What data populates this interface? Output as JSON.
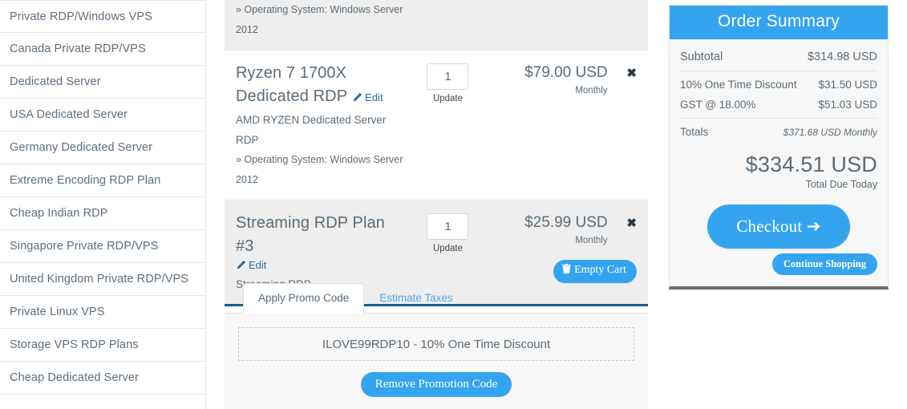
{
  "sidebar": {
    "items": [
      {
        "label": "Private RDP/Windows VPS"
      },
      {
        "label": "Canada Private RDP/VPS"
      },
      {
        "label": "Dedicated Server"
      },
      {
        "label": "USA Dedicated Server"
      },
      {
        "label": "Germany Dedicated Server"
      },
      {
        "label": "Extreme Encoding RDP Plan"
      },
      {
        "label": "Cheap Indian RDP"
      },
      {
        "label": "Singapore Private RDP/VPS"
      },
      {
        "label": "United Kingdom Private RDP/VPS"
      },
      {
        "label": "Private Linux VPS"
      },
      {
        "label": "Storage VPS RDP Plans"
      },
      {
        "label": "Cheap Dedicated Server"
      }
    ]
  },
  "cart": {
    "items": [
      {
        "title": "",
        "edit_label": "",
        "description": "",
        "config": "» Operating System: Windows Server 2012",
        "qty": "",
        "update_label": "",
        "price": "",
        "cycle": "",
        "remove_label": ""
      },
      {
        "title": "Ryzen 7 1700X Dedicated RDP",
        "edit_label": "Edit",
        "description": "AMD RYZEN Dedicated Server RDP",
        "config": "» Operating System: Windows Server 2012",
        "qty": "1",
        "update_label": "Update",
        "price": "$79.00 USD",
        "cycle": "Monthly",
        "remove_label": "✖"
      },
      {
        "title": "Streaming RDP Plan #3",
        "edit_label": "Edit",
        "description": "Streaming RDP",
        "config": "",
        "qty": "1",
        "update_label": "Update",
        "price": "$25.99 USD",
        "cycle": "Monthly",
        "remove_label": "✖"
      }
    ],
    "empty_cart_label": "Empty Cart"
  },
  "promo": {
    "tab_apply": "Apply Promo Code",
    "tab_taxes": "Estimate Taxes",
    "applied_code": "ILOVE99RDP10 - 10% One Time Discount",
    "remove_label": "Remove Promotion Code"
  },
  "summary": {
    "title": "Order Summary",
    "subtotal_label": "Subtotal",
    "subtotal_value": "$314.98 USD",
    "lines": [
      {
        "label": "10% One Time Discount",
        "value": "$31.50 USD"
      },
      {
        "label": "GST @ 18.00%",
        "value": "$51.03 USD"
      }
    ],
    "totals_label": "Totals",
    "totals_value": "$371.68 USD Monthly",
    "total_amount": "$334.51 USD",
    "total_caption": "Total Due Today",
    "checkout_label": "Checkout",
    "checkout_arrow": "➔",
    "continue_label": "Continue Shopping"
  },
  "colors": {
    "accent_blue": "#35a4ef",
    "link_blue": "#2b6ca3",
    "text_gray": "#5b6b77",
    "panel_gray": "#eeeeee",
    "item_bottom_blue": "#1a5c86"
  }
}
